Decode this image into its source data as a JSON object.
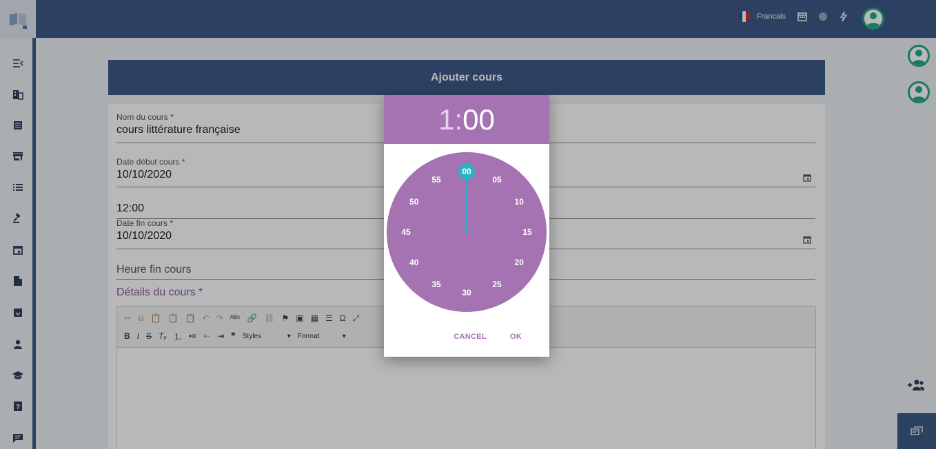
{
  "topbar": {
    "language": "Francais",
    "icons": [
      "flag-fr-icon",
      "calendar-icon",
      "palette-icon",
      "flash-icon",
      "search-icon",
      "user-avatar-icon"
    ]
  },
  "sidebar": {
    "items": [
      {
        "name": "menu-collapse-icon"
      },
      {
        "name": "business-icon"
      },
      {
        "name": "list-alt-icon"
      },
      {
        "name": "store-icon"
      },
      {
        "name": "list-icon"
      },
      {
        "name": "gavel-icon"
      },
      {
        "name": "event-icon"
      },
      {
        "name": "description-icon"
      },
      {
        "name": "archive-icon"
      },
      {
        "name": "person-icon"
      },
      {
        "name": "school-icon"
      },
      {
        "name": "help-icon"
      },
      {
        "name": "chat-icon"
      }
    ]
  },
  "page": {
    "title": "Ajouter cours"
  },
  "form": {
    "course_name_label": "Nom du cours *",
    "course_name_value": "cours littérature française",
    "start_date_label": "Date début cours *",
    "start_date_value": "10/10/2020",
    "start_time_value": "12:00",
    "end_date_label": "Date fin cours *",
    "end_date_value": "10/10/2020",
    "end_time_placeholder": "Heure fin cours",
    "details_label": "Détails du cours *"
  },
  "editor": {
    "styles_label": "Styles",
    "format_label": "Format"
  },
  "timepicker": {
    "hour": "1",
    "separator": ":",
    "minutes": "00",
    "dial_labels": [
      "00",
      "05",
      "10",
      "15",
      "20",
      "25",
      "30",
      "35",
      "40",
      "45",
      "50",
      "55"
    ],
    "selected_minute": 0,
    "cancel_label": "CANCEL",
    "ok_label": "OK",
    "accent_color": "#a572b2",
    "hand_color": "#2ab3c6"
  }
}
